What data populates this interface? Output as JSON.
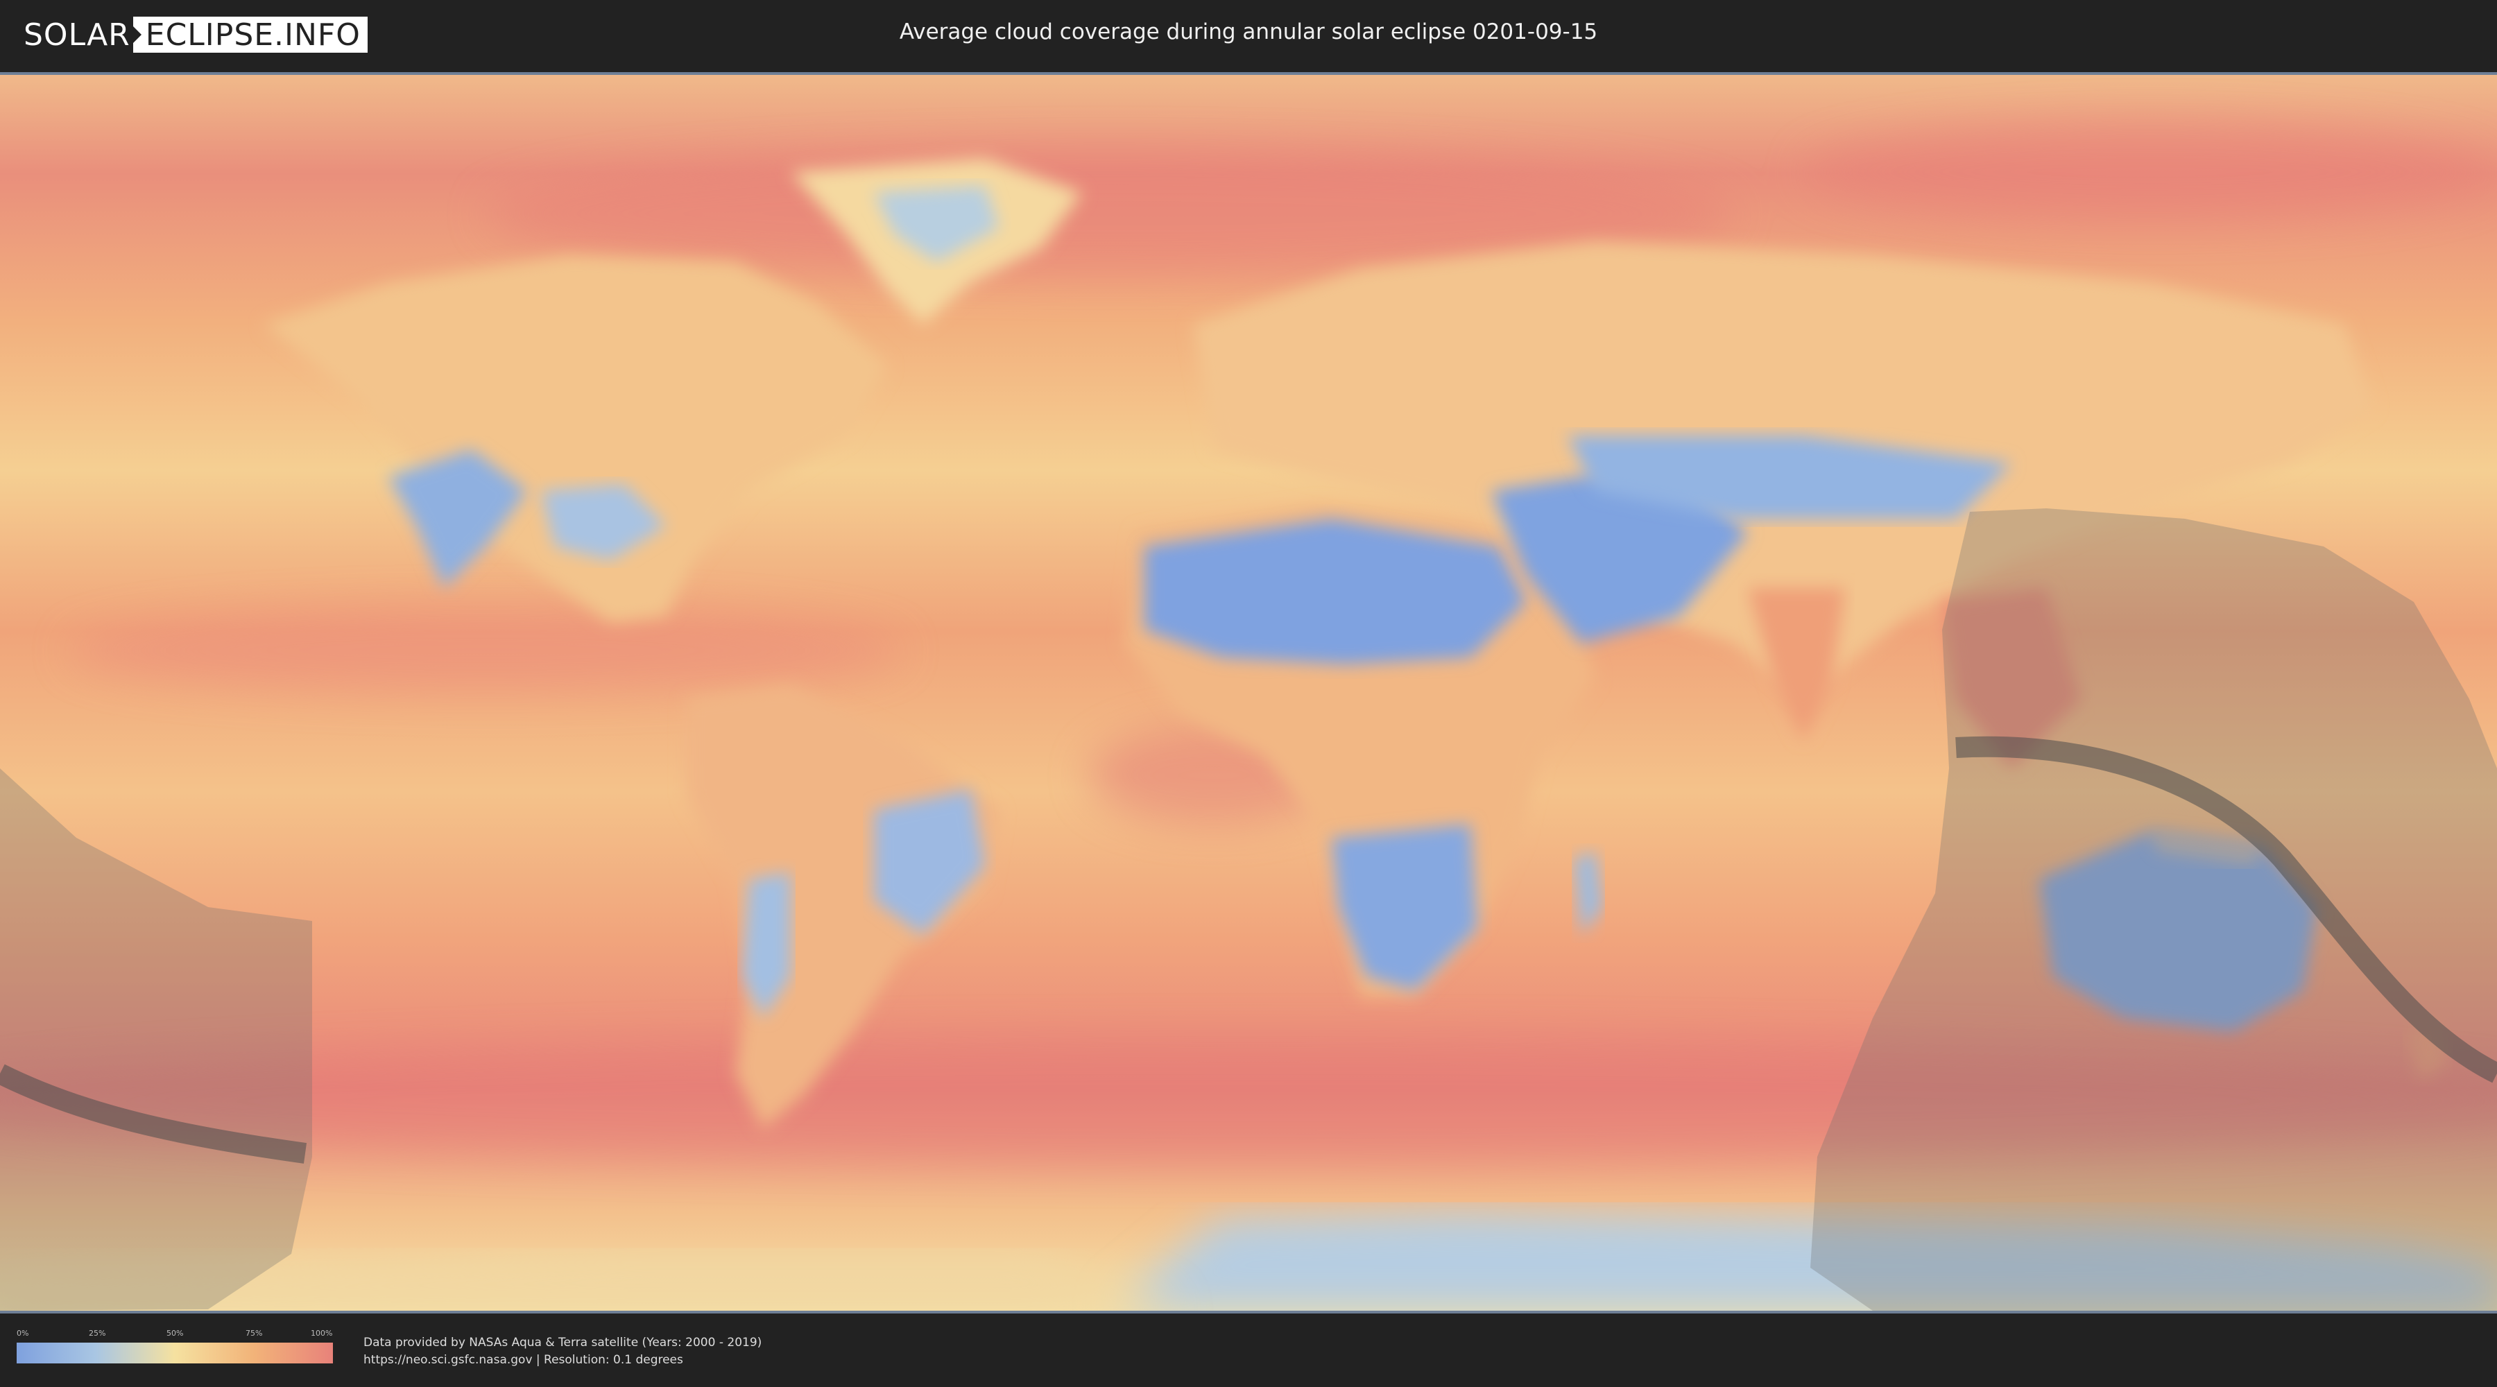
{
  "header": {
    "logo_left": "SOLAR",
    "logo_right": "ECLIPSE.INFO",
    "title": "Average cloud coverage during annular solar eclipse 0201-09-15"
  },
  "legend": {
    "ticks": [
      "0%",
      "25%",
      "50%",
      "75%",
      "100%"
    ],
    "colors": [
      "#7fa1de",
      "#a9c6e3",
      "#f5e1a0",
      "#f2b379",
      "#e8827a"
    ]
  },
  "footer": {
    "line1": "Data provided by NASAs Aqua & Terra satellite (Years: 2000 - 2019)",
    "line2": "https://neo.sci.gsfc.nasa.gov | Resolution: 0.1 degrees"
  }
}
